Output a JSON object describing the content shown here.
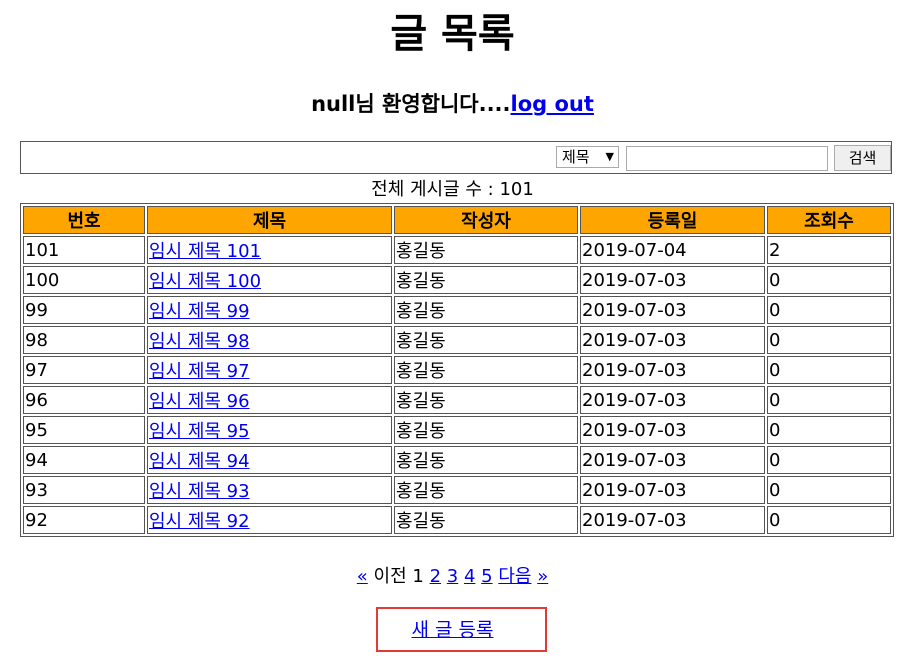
{
  "page": {
    "title": "글 목록"
  },
  "welcome": {
    "text": "null님 환영합니다....",
    "logout_label": "log out"
  },
  "search": {
    "condition": "제목",
    "query": "",
    "button_label": "검색"
  },
  "total": {
    "label": "전체 게시글 수 : 101"
  },
  "board": {
    "headers": [
      "번호",
      "제목",
      "작성자",
      "등록일",
      "조회수"
    ],
    "rows": [
      {
        "no": "101",
        "title": "임시 제목 101",
        "writer": "홍길동",
        "date": "2019-07-04",
        "views": "2"
      },
      {
        "no": "100",
        "title": "임시 제목 100",
        "writer": "홍길동",
        "date": "2019-07-03",
        "views": "0"
      },
      {
        "no": "99",
        "title": "임시 제목 99",
        "writer": "홍길동",
        "date": "2019-07-03",
        "views": "0"
      },
      {
        "no": "98",
        "title": "임시 제목 98",
        "writer": "홍길동",
        "date": "2019-07-03",
        "views": "0"
      },
      {
        "no": "97",
        "title": "임시 제목 97",
        "writer": "홍길동",
        "date": "2019-07-03",
        "views": "0"
      },
      {
        "no": "96",
        "title": "임시 제목 96",
        "writer": "홍길동",
        "date": "2019-07-03",
        "views": "0"
      },
      {
        "no": "95",
        "title": "임시 제목 95",
        "writer": "홍길동",
        "date": "2019-07-03",
        "views": "0"
      },
      {
        "no": "94",
        "title": "임시 제목 94",
        "writer": "홍길동",
        "date": "2019-07-03",
        "views": "0"
      },
      {
        "no": "93",
        "title": "임시 제목 93",
        "writer": "홍길동",
        "date": "2019-07-03",
        "views": "0"
      },
      {
        "no": "92",
        "title": "임시 제목 92",
        "writer": "홍길동",
        "date": "2019-07-03",
        "views": "0"
      }
    ]
  },
  "pager": {
    "prev_arrow": "«",
    "prev_label": "이전",
    "current_page": "1",
    "pages": [
      "2",
      "3",
      "4",
      "5"
    ],
    "next_label": "다음",
    "next_arrow": "»"
  },
  "actions": {
    "new_post_label": "새 글 등록"
  },
  "colors": {
    "header_bg": "#ffa500",
    "link": "#0000ee",
    "highlight_border": "#e53935"
  }
}
